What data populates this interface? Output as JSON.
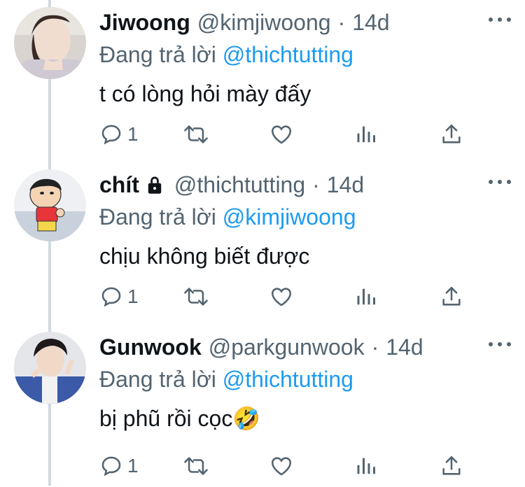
{
  "tweets": [
    {
      "name": "Jiwoong",
      "handle": "@kimjiwoong",
      "dot": "·",
      "time": "14d",
      "reply_prefix": "Đang trả lời",
      "reply_to": "@thichtutting",
      "text": "t có lòng hỏi mày đấy",
      "reply_count": "1",
      "locked": false
    },
    {
      "name": "chít",
      "handle": "@thichtutting",
      "dot": "·",
      "time": "14d",
      "reply_prefix": "Đang trả lời",
      "reply_to": "@kimjiwoong",
      "text": "chịu không biết được",
      "reply_count": "1",
      "locked": true
    },
    {
      "name": "Gunwook",
      "handle": "@parkgunwook",
      "dot": "·",
      "time": "14d",
      "reply_prefix": "Đang trả lời",
      "reply_to": "@thichtutting",
      "text": "bị phũ rồi cọc",
      "emoji": "🤣",
      "reply_count": "1",
      "locked": false
    }
  ],
  "icons": {
    "reply": "speech-bubble-icon",
    "retweet": "retweet-icon",
    "like": "heart-icon",
    "views": "analytics-icon",
    "share": "share-icon",
    "more": "more-dots-icon",
    "lock": "lock-icon"
  },
  "colors": {
    "text": "#0f1419",
    "secondary": "#536471",
    "mention": "#1d9bf0",
    "thread_line": "#cfd9de"
  }
}
